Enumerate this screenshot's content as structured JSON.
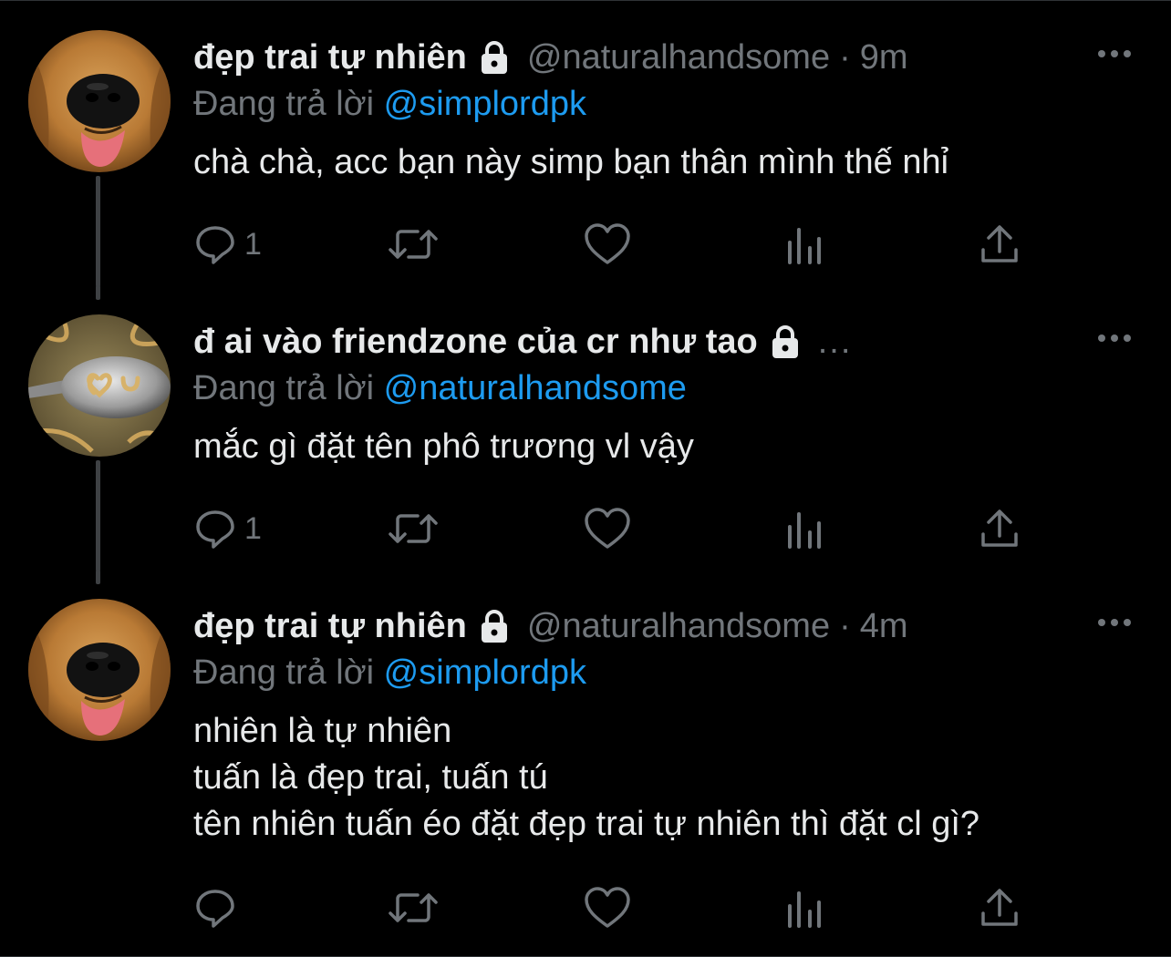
{
  "colors": {
    "background": "#000000",
    "text_primary": "#e7e9ea",
    "text_secondary": "#71767b",
    "mention": "#1d9bf0",
    "thread_line": "#3e4144"
  },
  "tweets": [
    {
      "avatar": "golden-retriever-face-avatar",
      "display_name": "đẹp trai tự nhiên",
      "locked_icon": "lock-icon",
      "handle": "@naturalhandsome",
      "separator": "·",
      "time": "9m",
      "replying_prefix": "Đang trả lời",
      "replying_to": "@simplordpk",
      "text_lines": [
        "chà chà, acc bạn này simp bạn thân mình thế nhỉ"
      ],
      "actions": {
        "reply_count": "1",
        "retweet_count": "",
        "like_count": ""
      }
    },
    {
      "avatar": "spoon-with-noodle-heart-avatar",
      "display_name": "đ ai vào friendzone của cr như tao",
      "locked_icon": "lock-icon",
      "truncation": "...",
      "replying_prefix": "Đang trả lời",
      "replying_to": "@naturalhandsome",
      "text_lines": [
        "mắc gì đặt tên phô trương vl vậy"
      ],
      "actions": {
        "reply_count": "1",
        "retweet_count": "",
        "like_count": ""
      }
    },
    {
      "avatar": "golden-retriever-face-avatar",
      "display_name": "đẹp trai tự nhiên",
      "locked_icon": "lock-icon",
      "handle": "@naturalhandsome",
      "separator": "·",
      "time": "4m",
      "replying_prefix": "Đang trả lời",
      "replying_to": "@simplordpk",
      "text_lines": [
        "nhiên là tự nhiên",
        "tuấn là đẹp trai, tuấn tú",
        "tên nhiên tuấn éo đặt đẹp trai tự nhiên thì đặt cl gì?"
      ],
      "actions": {
        "reply_count": "",
        "retweet_count": "",
        "like_count": ""
      }
    }
  ]
}
